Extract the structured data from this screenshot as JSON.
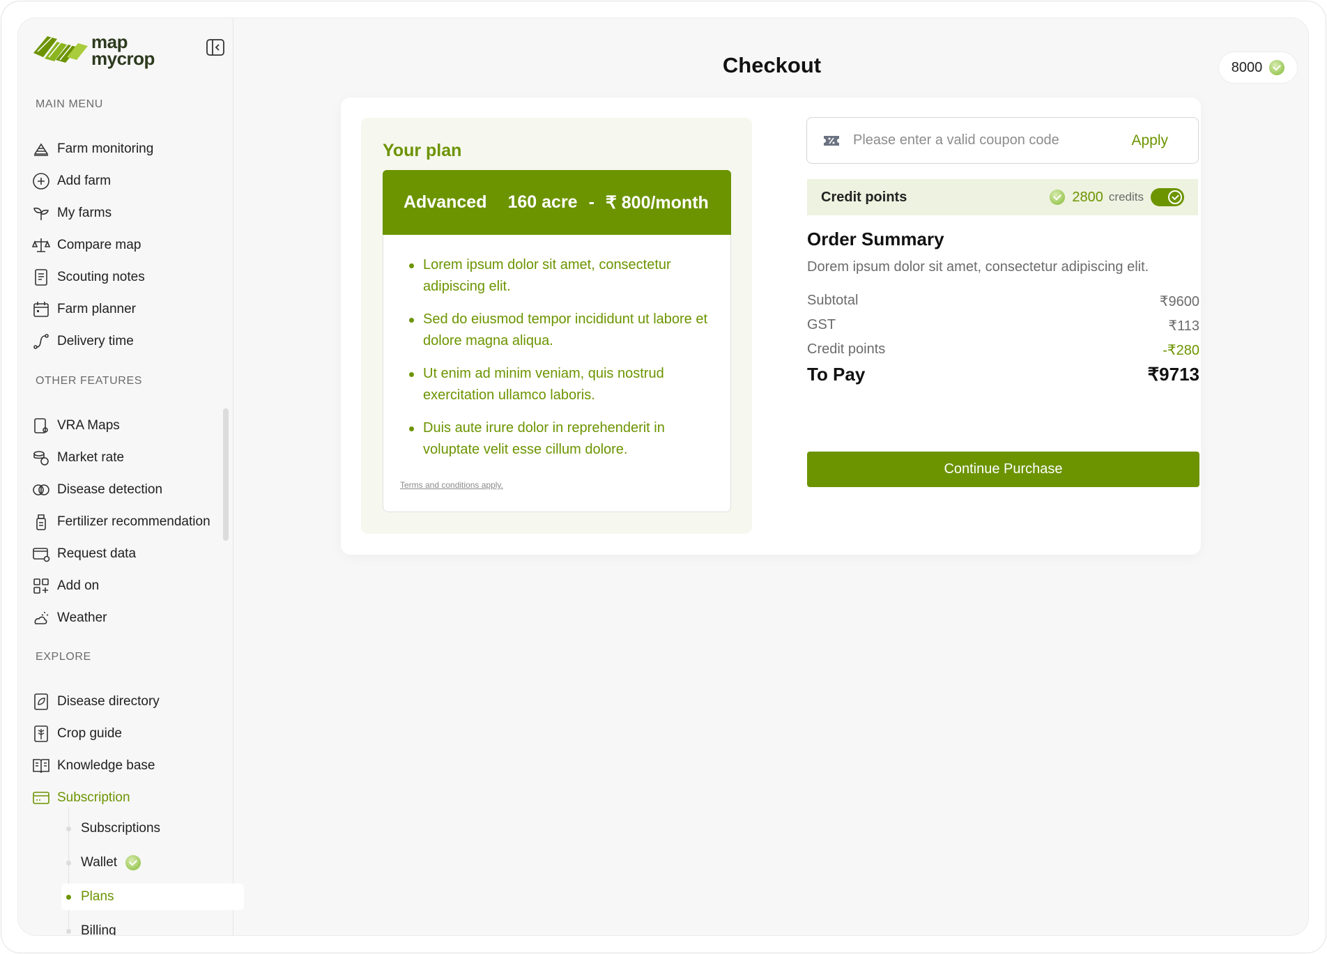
{
  "app": {
    "logo_line1": "map",
    "logo_line2": "mycrop",
    "page_title": "Checkout",
    "wallet_balance": "8000"
  },
  "sidebar": {
    "main_menu_title": "MAIN MENU",
    "main_menu": [
      {
        "label": "Farm monitoring",
        "icon": "farm-icon"
      },
      {
        "label": "Add farm",
        "icon": "plus-circle-icon"
      },
      {
        "label": "My farms",
        "icon": "sprout-icon"
      },
      {
        "label": "Compare map",
        "icon": "scale-icon"
      },
      {
        "label": "Scouting notes",
        "icon": "notes-icon"
      },
      {
        "label": "Farm planner",
        "icon": "calendar-icon"
      },
      {
        "label": "Delivery time",
        "icon": "route-icon"
      }
    ],
    "other_features_title": "OTHER FEATURES",
    "other_features": [
      {
        "label": "VRA Maps",
        "icon": "vra-map-icon"
      },
      {
        "label": "Market rate",
        "icon": "coins-icon"
      },
      {
        "label": "Disease detection",
        "icon": "disease-icon"
      },
      {
        "label": "Fertilizer recommendation",
        "icon": "fertilizer-icon"
      },
      {
        "label": "Request data",
        "icon": "request-data-icon"
      },
      {
        "label": "Add on",
        "icon": "add-on-icon"
      },
      {
        "label": "Weather",
        "icon": "weather-icon"
      }
    ],
    "explore_title": "EXPLORE",
    "explore": [
      {
        "label": "Disease directory",
        "icon": "leaf-book-icon"
      },
      {
        "label": "Crop guide",
        "icon": "crop-guide-icon"
      },
      {
        "label": "Knowledge base",
        "icon": "book-icon"
      },
      {
        "label": "Subscription",
        "icon": "card-icon",
        "active": true
      }
    ],
    "subscription_items": [
      {
        "label": "Subscriptions"
      },
      {
        "label": "Wallet"
      },
      {
        "label": "Plans",
        "active": true
      },
      {
        "label": "Billing"
      }
    ]
  },
  "plan": {
    "heading": "Your plan",
    "name": "Advanced",
    "area": "160 acre",
    "separator": "-",
    "price": "₹ 800/month",
    "features": [
      "Lorem ipsum dolor sit amet, consectetur adipiscing elit.",
      "Sed do eiusmod tempor incididunt ut labore et dolore magna aliqua.",
      "Ut enim ad minim veniam, quis nostrud exercitation ullamco laboris.",
      "Duis aute irure dolor in reprehenderit in voluptate velit esse cillum dolore."
    ],
    "terms": "Terms and conditions apply."
  },
  "coupon": {
    "placeholder": "Please enter a valid coupon code",
    "value": "",
    "apply_label": "Apply"
  },
  "credits": {
    "label": "Credit points",
    "value": "2800",
    "unit": "credits",
    "enabled": true
  },
  "summary": {
    "title": "Order Summary",
    "description": "Dorem ipsum dolor sit amet, consectetur adipiscing elit.",
    "lines": [
      {
        "label": "Subtotal",
        "value": "₹9600"
      },
      {
        "label": "GST",
        "value": "₹113"
      },
      {
        "label": "Credit points",
        "value": "-₹280"
      }
    ],
    "total_label": "To Pay",
    "total_value": "₹9713",
    "continue_label": "Continue Purchase"
  },
  "colors": {
    "brand_green": "#6c9400",
    "credit_bg": "#eef2e0",
    "plan_panel_bg": "#f6f7ef"
  }
}
